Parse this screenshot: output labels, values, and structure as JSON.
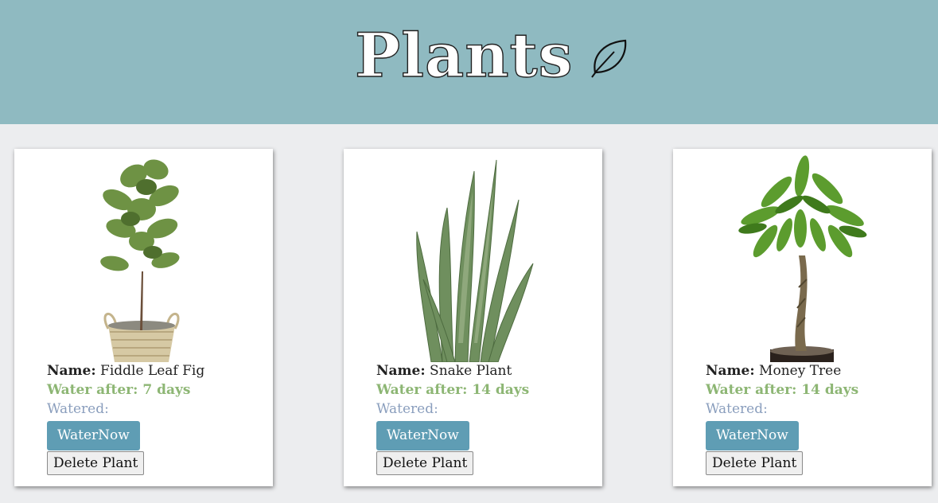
{
  "header": {
    "title": "Plants",
    "icon": "leaf-icon",
    "background": "#8fbac1"
  },
  "plants": [
    {
      "name_label": "Name:",
      "name": "Fiddle Leaf Fig",
      "water_after": "Water after: 7 days",
      "watered": "Watered:",
      "water_button": "WaterNow",
      "delete_button": "Delete Plant",
      "image": "fiddle-leaf-fig-plant-image"
    },
    {
      "name_label": "Name:",
      "name": "Snake Plant",
      "water_after": "Water after: 14 days",
      "watered": "Watered:",
      "water_button": "WaterNow",
      "delete_button": "Delete Plant",
      "image": "snake-plant-image"
    },
    {
      "name_label": "Name:",
      "name": "Money Tree",
      "water_after": "Water after: 14 days",
      "watered": "Watered:",
      "water_button": "WaterNow",
      "delete_button": "Delete Plant",
      "image": "money-tree-plant-image"
    }
  ],
  "colors": {
    "water_button": "#5f9db4",
    "water_after_text": "#8db674",
    "watered_text": "#8a9ebd",
    "page_background": "#ecedef"
  }
}
